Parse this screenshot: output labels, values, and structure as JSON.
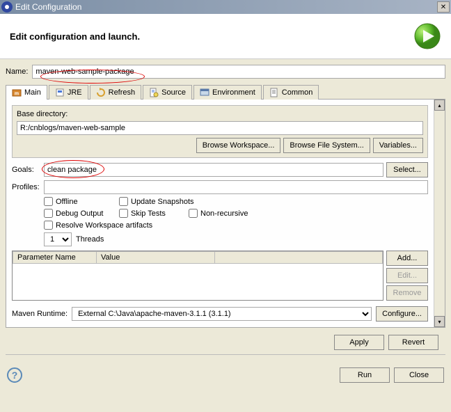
{
  "window": {
    "title": "Edit Configuration"
  },
  "header": {
    "title": "Edit configuration and launch."
  },
  "name": {
    "label": "Name:",
    "value": "maven-web-sample-package"
  },
  "tabs": [
    {
      "label": "Main"
    },
    {
      "label": "JRE"
    },
    {
      "label": "Refresh"
    },
    {
      "label": "Source"
    },
    {
      "label": "Environment"
    },
    {
      "label": "Common"
    }
  ],
  "main": {
    "base_directory_label": "Base directory:",
    "base_directory": "R:/cnblogs/maven-web-sample",
    "browse_workspace": "Browse Workspace...",
    "browse_filesystem": "Browse File System...",
    "variables": "Variables...",
    "goals_label": "Goals:",
    "goals": "clean package",
    "select": "Select...",
    "profiles_label": "Profiles:",
    "profiles": "",
    "offline": "Offline",
    "update_snapshots": "Update Snapshots",
    "debug_output": "Debug Output",
    "skip_tests": "Skip Tests",
    "non_recursive": "Non-recursive",
    "resolve_workspace": "Resolve Workspace artifacts",
    "threads_value": "1",
    "threads_label": "Threads",
    "table": {
      "param_name": "Parameter Name",
      "value": "Value"
    },
    "add": "Add...",
    "edit": "Edit...",
    "remove": "Remove",
    "maven_runtime_label": "Maven Runtime:",
    "maven_runtime": "External C:\\Java\\apache-maven-3.1.1 (3.1.1)",
    "configure": "Configure..."
  },
  "footer": {
    "apply": "Apply",
    "revert": "Revert",
    "run": "Run",
    "close": "Close"
  }
}
